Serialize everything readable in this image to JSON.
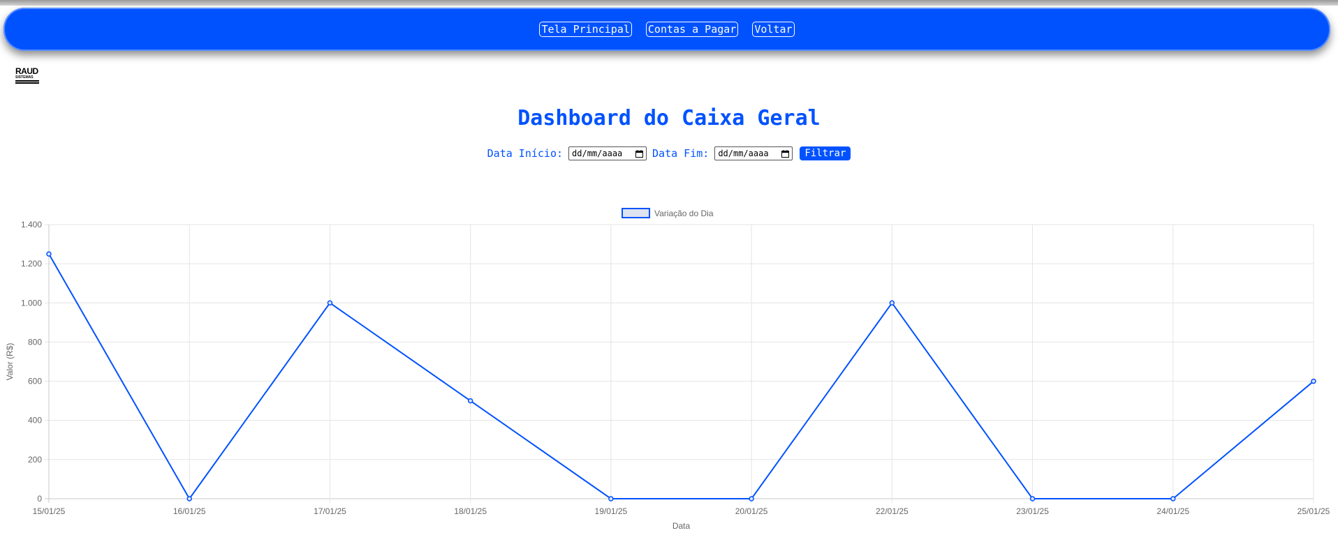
{
  "nav": {
    "items": [
      {
        "label": "Tela Principal"
      },
      {
        "label": "Contas a Pagar"
      },
      {
        "label": "Voltar"
      }
    ]
  },
  "logo": {
    "line1": "RAUD",
    "line2": "SISTEMAS"
  },
  "page": {
    "title": "Dashboard do Caixa Geral"
  },
  "filters": {
    "start_label": "Data Início:",
    "start_value": "dd/mm/aaaa",
    "end_label": "Data Fim:",
    "end_value": "dd/mm/aaaa",
    "button_label": "Filtrar"
  },
  "colors": {
    "accent": "#0052ff",
    "legend_fill": "#dde3f0"
  },
  "chart_data": {
    "type": "line",
    "title": "",
    "xlabel": "Data",
    "ylabel": "Valor (R$)",
    "ylim": [
      0,
      1400
    ],
    "y_ticks": [
      "0",
      "200",
      "400",
      "600",
      "800",
      "1.000",
      "1.200",
      "1.400"
    ],
    "categories": [
      "15/01/25",
      "16/01/25",
      "17/01/25",
      "18/01/25",
      "19/01/25",
      "20/01/25",
      "22/01/25",
      "23/01/25",
      "24/01/25",
      "25/01/25"
    ],
    "series": [
      {
        "name": "Variação do Dia",
        "values": [
          1250,
          0,
          1000,
          500,
          0,
          0,
          1000,
          0,
          0,
          600
        ]
      }
    ],
    "grid": true,
    "legend": "top-center"
  }
}
